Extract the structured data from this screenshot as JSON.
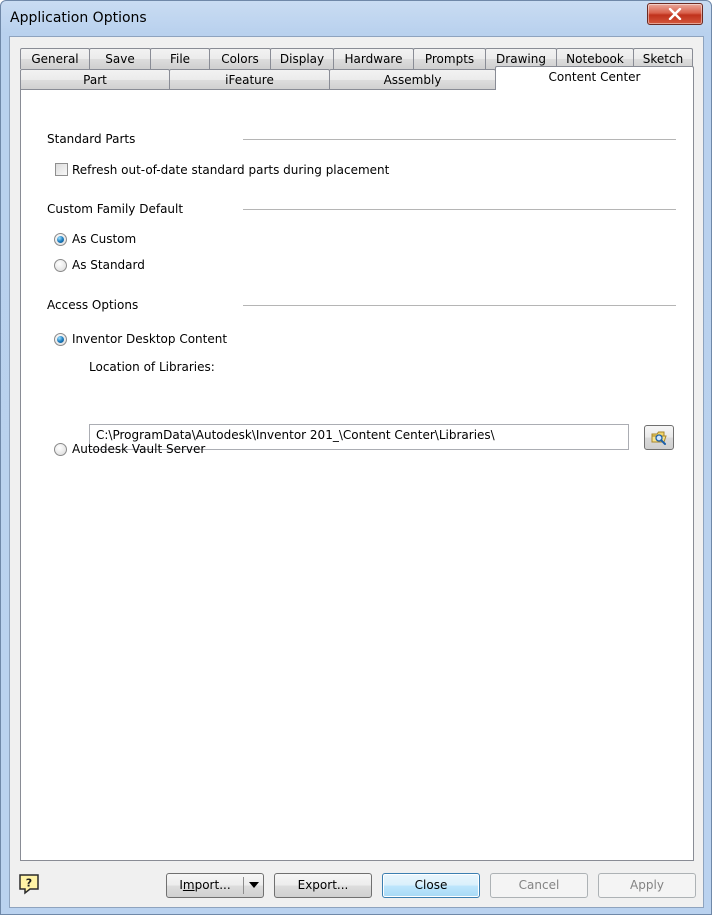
{
  "window": {
    "title": "Application Options"
  },
  "tabs_row1": [
    "General",
    "Save",
    "File",
    "Colors",
    "Display",
    "Hardware",
    "Prompts",
    "Drawing",
    "Notebook",
    "Sketch"
  ],
  "tabs_row2": [
    "Part",
    "iFeature",
    "Assembly",
    "Content Center"
  ],
  "active_tab": "Content Center",
  "standard_parts": {
    "label": "Standard Parts",
    "refresh_checkbox": {
      "label": "Refresh out-of-date standard parts during placement",
      "checked": false
    }
  },
  "custom_family_default": {
    "label": "Custom Family Default",
    "as_custom": {
      "label": "As Custom",
      "selected": true
    },
    "as_standard": {
      "label": "As Standard",
      "selected": false
    }
  },
  "access_options": {
    "label": "Access Options",
    "inventor_desktop": {
      "label": "Inventor Desktop Content",
      "selected": true
    },
    "location_label": "Location of Libraries:",
    "location_value": "C:\\ProgramData\\Autodesk\\Inventor 201_\\Content Center\\Libraries\\",
    "vault_server": {
      "label": "Autodesk Vault Server",
      "selected": false
    }
  },
  "footer": {
    "import_prefix": "I",
    "import_underlined": "m",
    "import_suffix": "port...",
    "export_label": "Export...",
    "close_label": "Close",
    "cancel_label": "Cancel",
    "apply_label": "Apply"
  },
  "icons": {
    "close": "close-x-icon",
    "browse": "folder-search-icon",
    "help": "help-question-icon",
    "dropdown": "triangle-down-icon"
  },
  "colors": {
    "title_bar": "#bad2ef",
    "close_button": "#c9452f",
    "default_button": "#bee6fd",
    "radio_selected": "#1f7fc0"
  }
}
